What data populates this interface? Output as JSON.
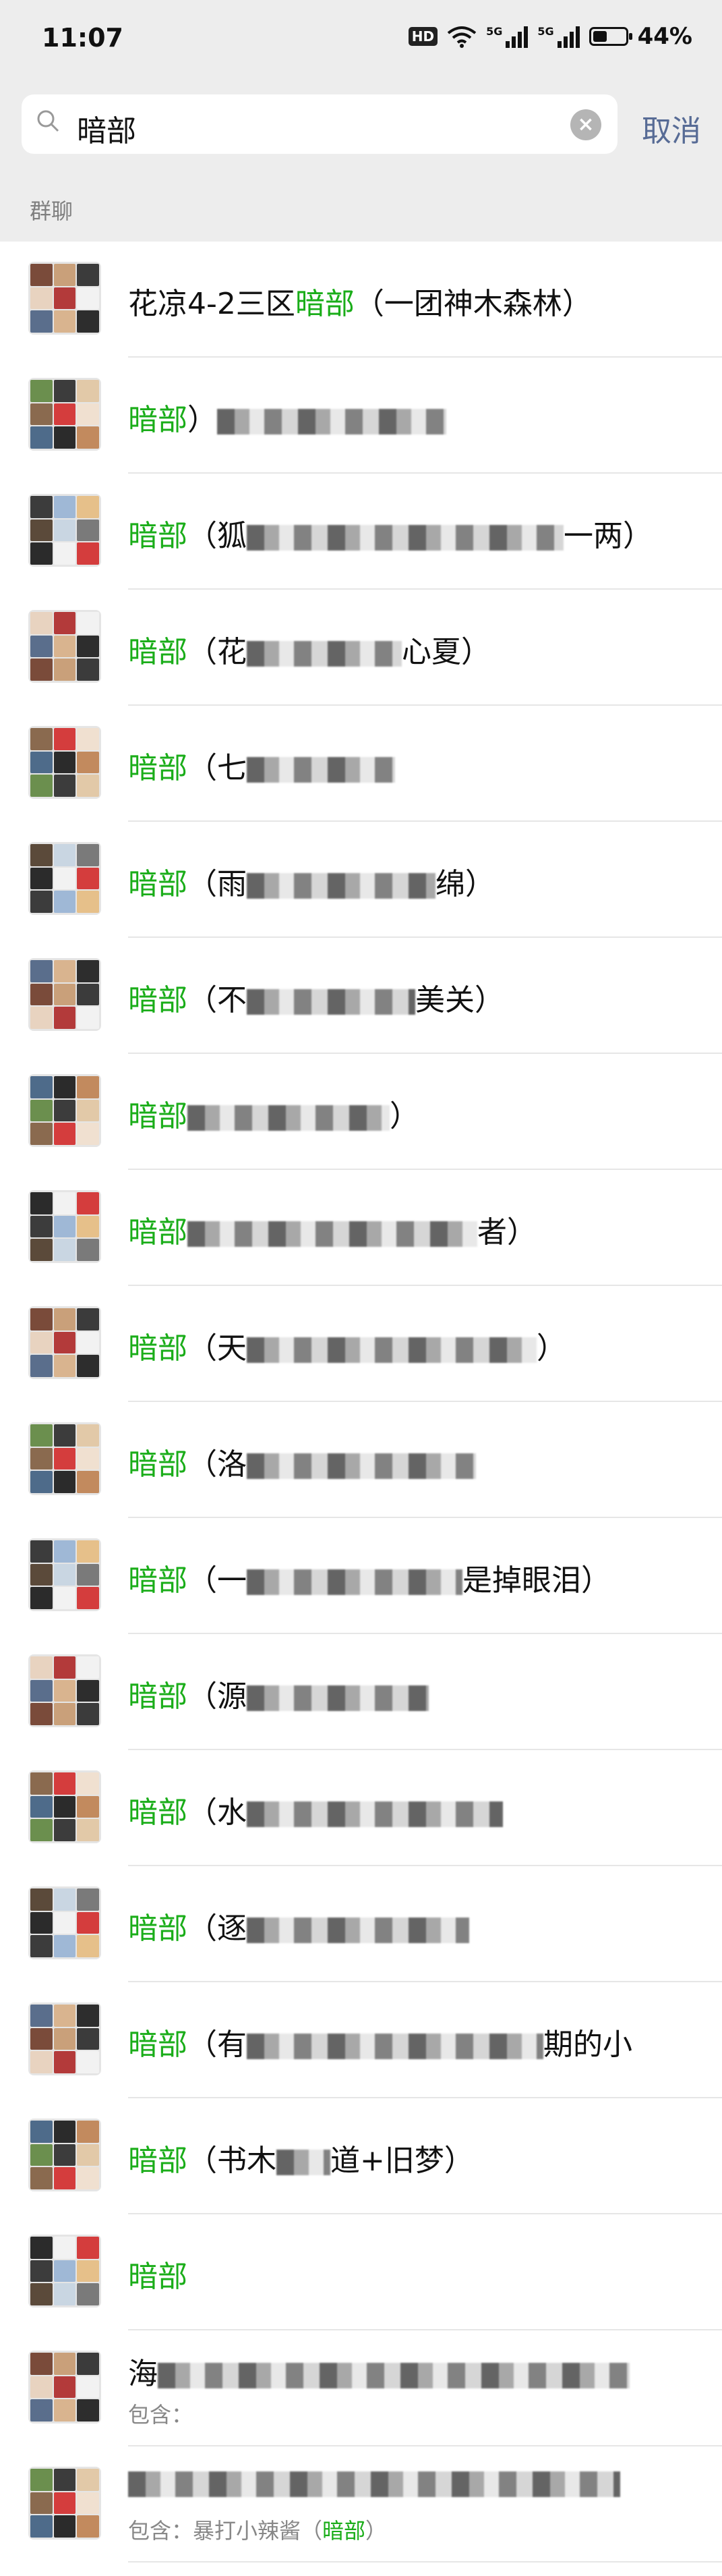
{
  "status_bar": {
    "time": "11:07",
    "hd_label": "HD",
    "signal1_label": "5G",
    "signal2_label": "5G",
    "battery_percent": 44,
    "battery_text": "44%"
  },
  "search": {
    "query": "暗部",
    "cancel_label": "取消"
  },
  "section_label": "群聊",
  "highlight_color": "#1aad19",
  "results": [
    {
      "prefix": "花凉4-2三区",
      "match": "暗部",
      "suffix": "（一团神木森林）",
      "blur_width": 0
    },
    {
      "prefix": "",
      "match": "暗部",
      "suffix": "）",
      "blur_width": 340
    },
    {
      "prefix": "",
      "match": "暗部",
      "suffix": "（狐",
      "tail": "一两）",
      "blur_width": 470
    },
    {
      "prefix": "",
      "match": "暗部",
      "suffix": "（花",
      "tail": "心夏）",
      "blur_width": 230
    },
    {
      "prefix": "",
      "match": "暗部",
      "suffix": "（七",
      "tail": "",
      "blur_width": 220
    },
    {
      "prefix": "",
      "match": "暗部",
      "suffix": "（雨",
      "tail": "绵）",
      "blur_width": 280
    },
    {
      "prefix": "",
      "match": "暗部",
      "suffix": "（不",
      "tail": "美关）",
      "blur_width": 250
    },
    {
      "prefix": "",
      "match": "暗部",
      "suffix": "",
      "tail": "）",
      "blur_width": 300
    },
    {
      "prefix": "",
      "match": "暗部",
      "suffix": "",
      "tail": "者）",
      "blur_width": 430
    },
    {
      "prefix": "",
      "match": "暗部",
      "suffix": "（天",
      "tail": "）",
      "blur_width": 430
    },
    {
      "prefix": "",
      "match": "暗部",
      "suffix": "（洛",
      "tail": "",
      "blur_width": 340
    },
    {
      "prefix": "",
      "match": "暗部",
      "suffix": "（一",
      "tail": "是掉眼泪）",
      "blur_width": 320
    },
    {
      "prefix": "",
      "match": "暗部",
      "suffix": "（源",
      "tail": "",
      "blur_width": 270
    },
    {
      "prefix": "",
      "match": "暗部",
      "suffix": "（水",
      "tail": "",
      "blur_width": 380
    },
    {
      "prefix": "",
      "match": "暗部",
      "suffix": "（逐",
      "tail": "",
      "blur_width": 330
    },
    {
      "prefix": "",
      "match": "暗部",
      "suffix": "（有",
      "tail": "期的小",
      "blur_width": 440
    },
    {
      "prefix": "",
      "match": "暗部",
      "suffix": "（书木",
      "tail": "道+旧梦）",
      "blur_width": 80
    },
    {
      "prefix": "",
      "match": "暗部",
      "suffix": "",
      "tail": "",
      "blur_width": 0
    },
    {
      "prefix": "海",
      "match": "",
      "suffix": "",
      "tail": "",
      "blur_width": 700,
      "sub": "包含：",
      "sub_match": "",
      "two_line": true
    },
    {
      "prefix": "",
      "match": "",
      "suffix": "",
      "tail": "",
      "blur_width": 730,
      "sub": "包含：暴打小辣酱（",
      "sub_match": "暗部",
      "sub_tail": "）",
      "two_line": true
    }
  ]
}
